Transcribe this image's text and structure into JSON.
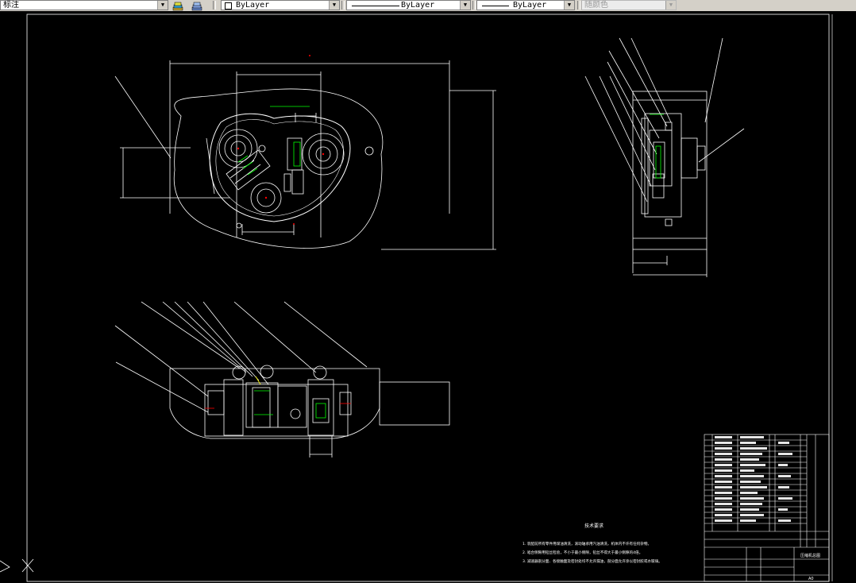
{
  "toolbar": {
    "dimstyle": "标注",
    "layer_color": "ByLayer",
    "linetype": "ByLayer",
    "lineweight": "ByLayer",
    "plotstyle": "随颜色"
  },
  "drawing": {
    "technical_req_title": "技术要求",
    "technical_req_lines": [
      "1. 装配前所有零件用煤油清洗，滚动轴承用汽油清洗，机体内不许有任何杂物。",
      "2. 啮合侧隙用铅丝检验，不小于最小侧隙，铅丝不得大于最小侧隙的4倍。",
      "3. 减速器剖分面、各接触面及密封处均不允许漏油，剖分面允许涂以密封胶或水玻璃。"
    ],
    "title_block_name": "压缩机总图",
    "sheet_label": "A0"
  },
  "colors": {
    "line": "#ffffff",
    "accent_green": "#00ff00",
    "accent_red": "#ff0000",
    "accent_yellow": "#ffff00",
    "toolbar_bg": "#d4d0c8"
  }
}
